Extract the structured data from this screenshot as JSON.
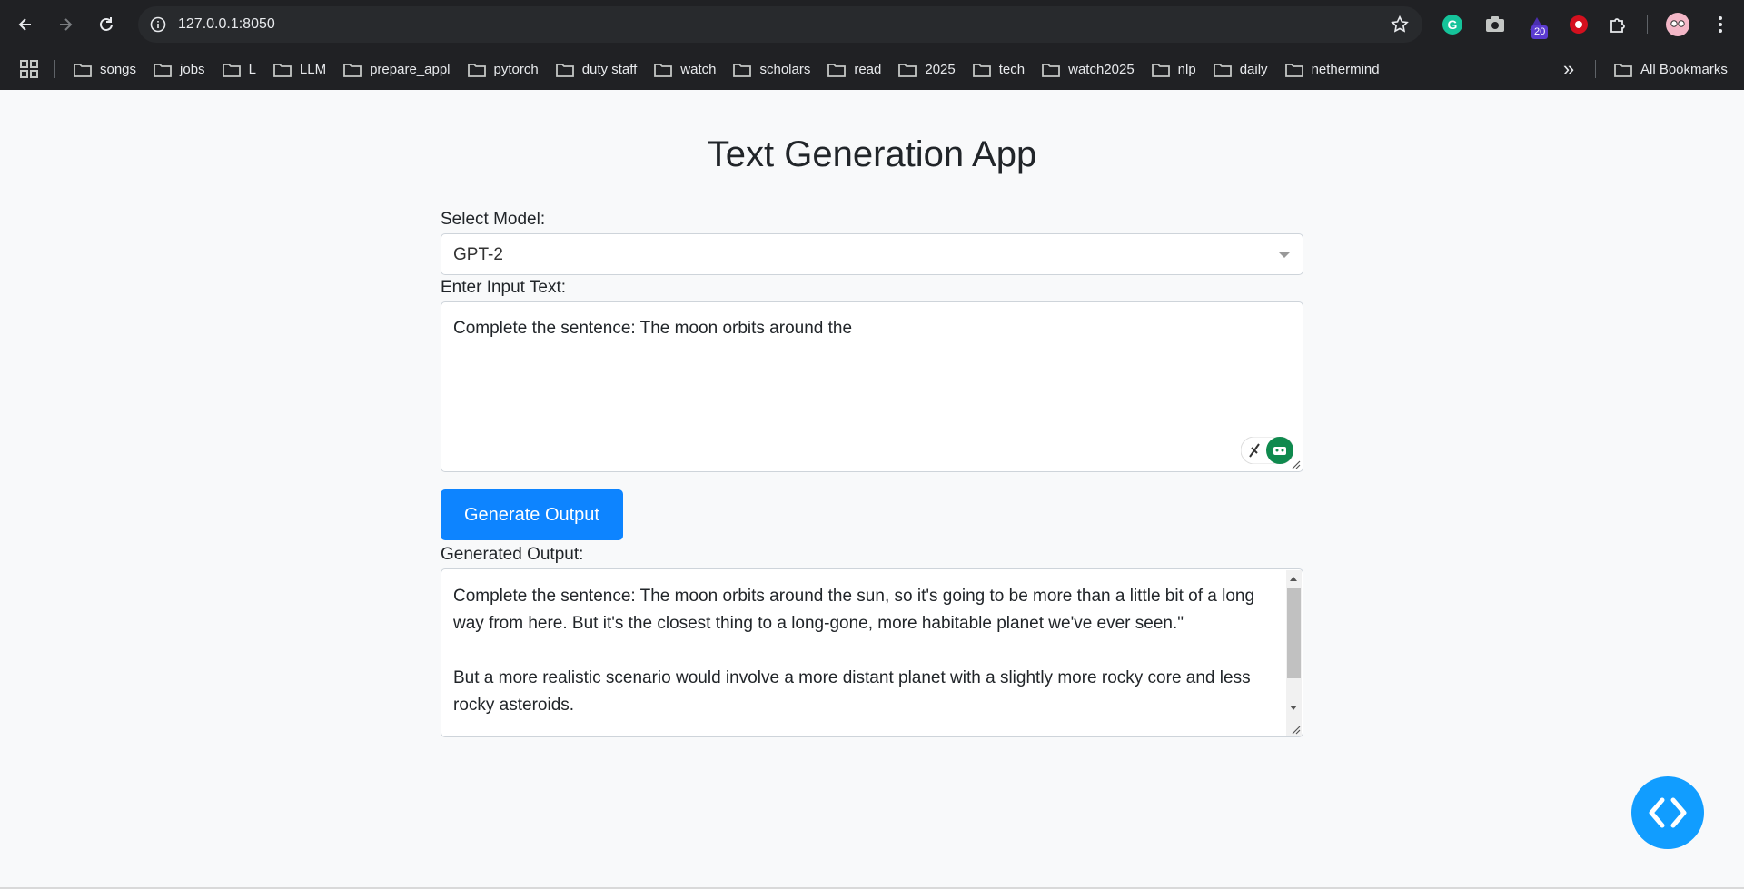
{
  "browser": {
    "url": "127.0.0.1:8050",
    "extension_badge": "20",
    "bookmarks": [
      "songs",
      "jobs",
      "L",
      "LLM",
      "prepare_appl",
      "pytorch",
      "duty staff",
      "watch",
      "scholars",
      "read",
      "2025",
      "tech",
      "watch2025",
      "nlp",
      "daily",
      "nethermind"
    ],
    "all_bookmarks_label": "All Bookmarks",
    "more_bookmarks": "»"
  },
  "app": {
    "title": "Text Generation App",
    "model_label": "Select Model:",
    "model_value": "GPT-2",
    "input_label": "Enter Input Text:",
    "input_value": "Complete the sentence: The moon orbits around the",
    "button_label": "Generate Output",
    "output_label": "Generated Output:",
    "output_paragraphs": [
      "Complete the sentence: The moon orbits around the sun, so it's going to be more than a little bit of a long way from here. But it's the closest thing to a long-gone, more habitable planet we've ever seen.\"",
      "But a more realistic scenario would involve a more distant planet with a slightly more rocky core and less rocky asteroids."
    ]
  },
  "colors": {
    "primary_button": "#0d84ff",
    "fab": "#119dff",
    "page_bg": "#f8f9fa",
    "chrome_bg": "#202124"
  }
}
